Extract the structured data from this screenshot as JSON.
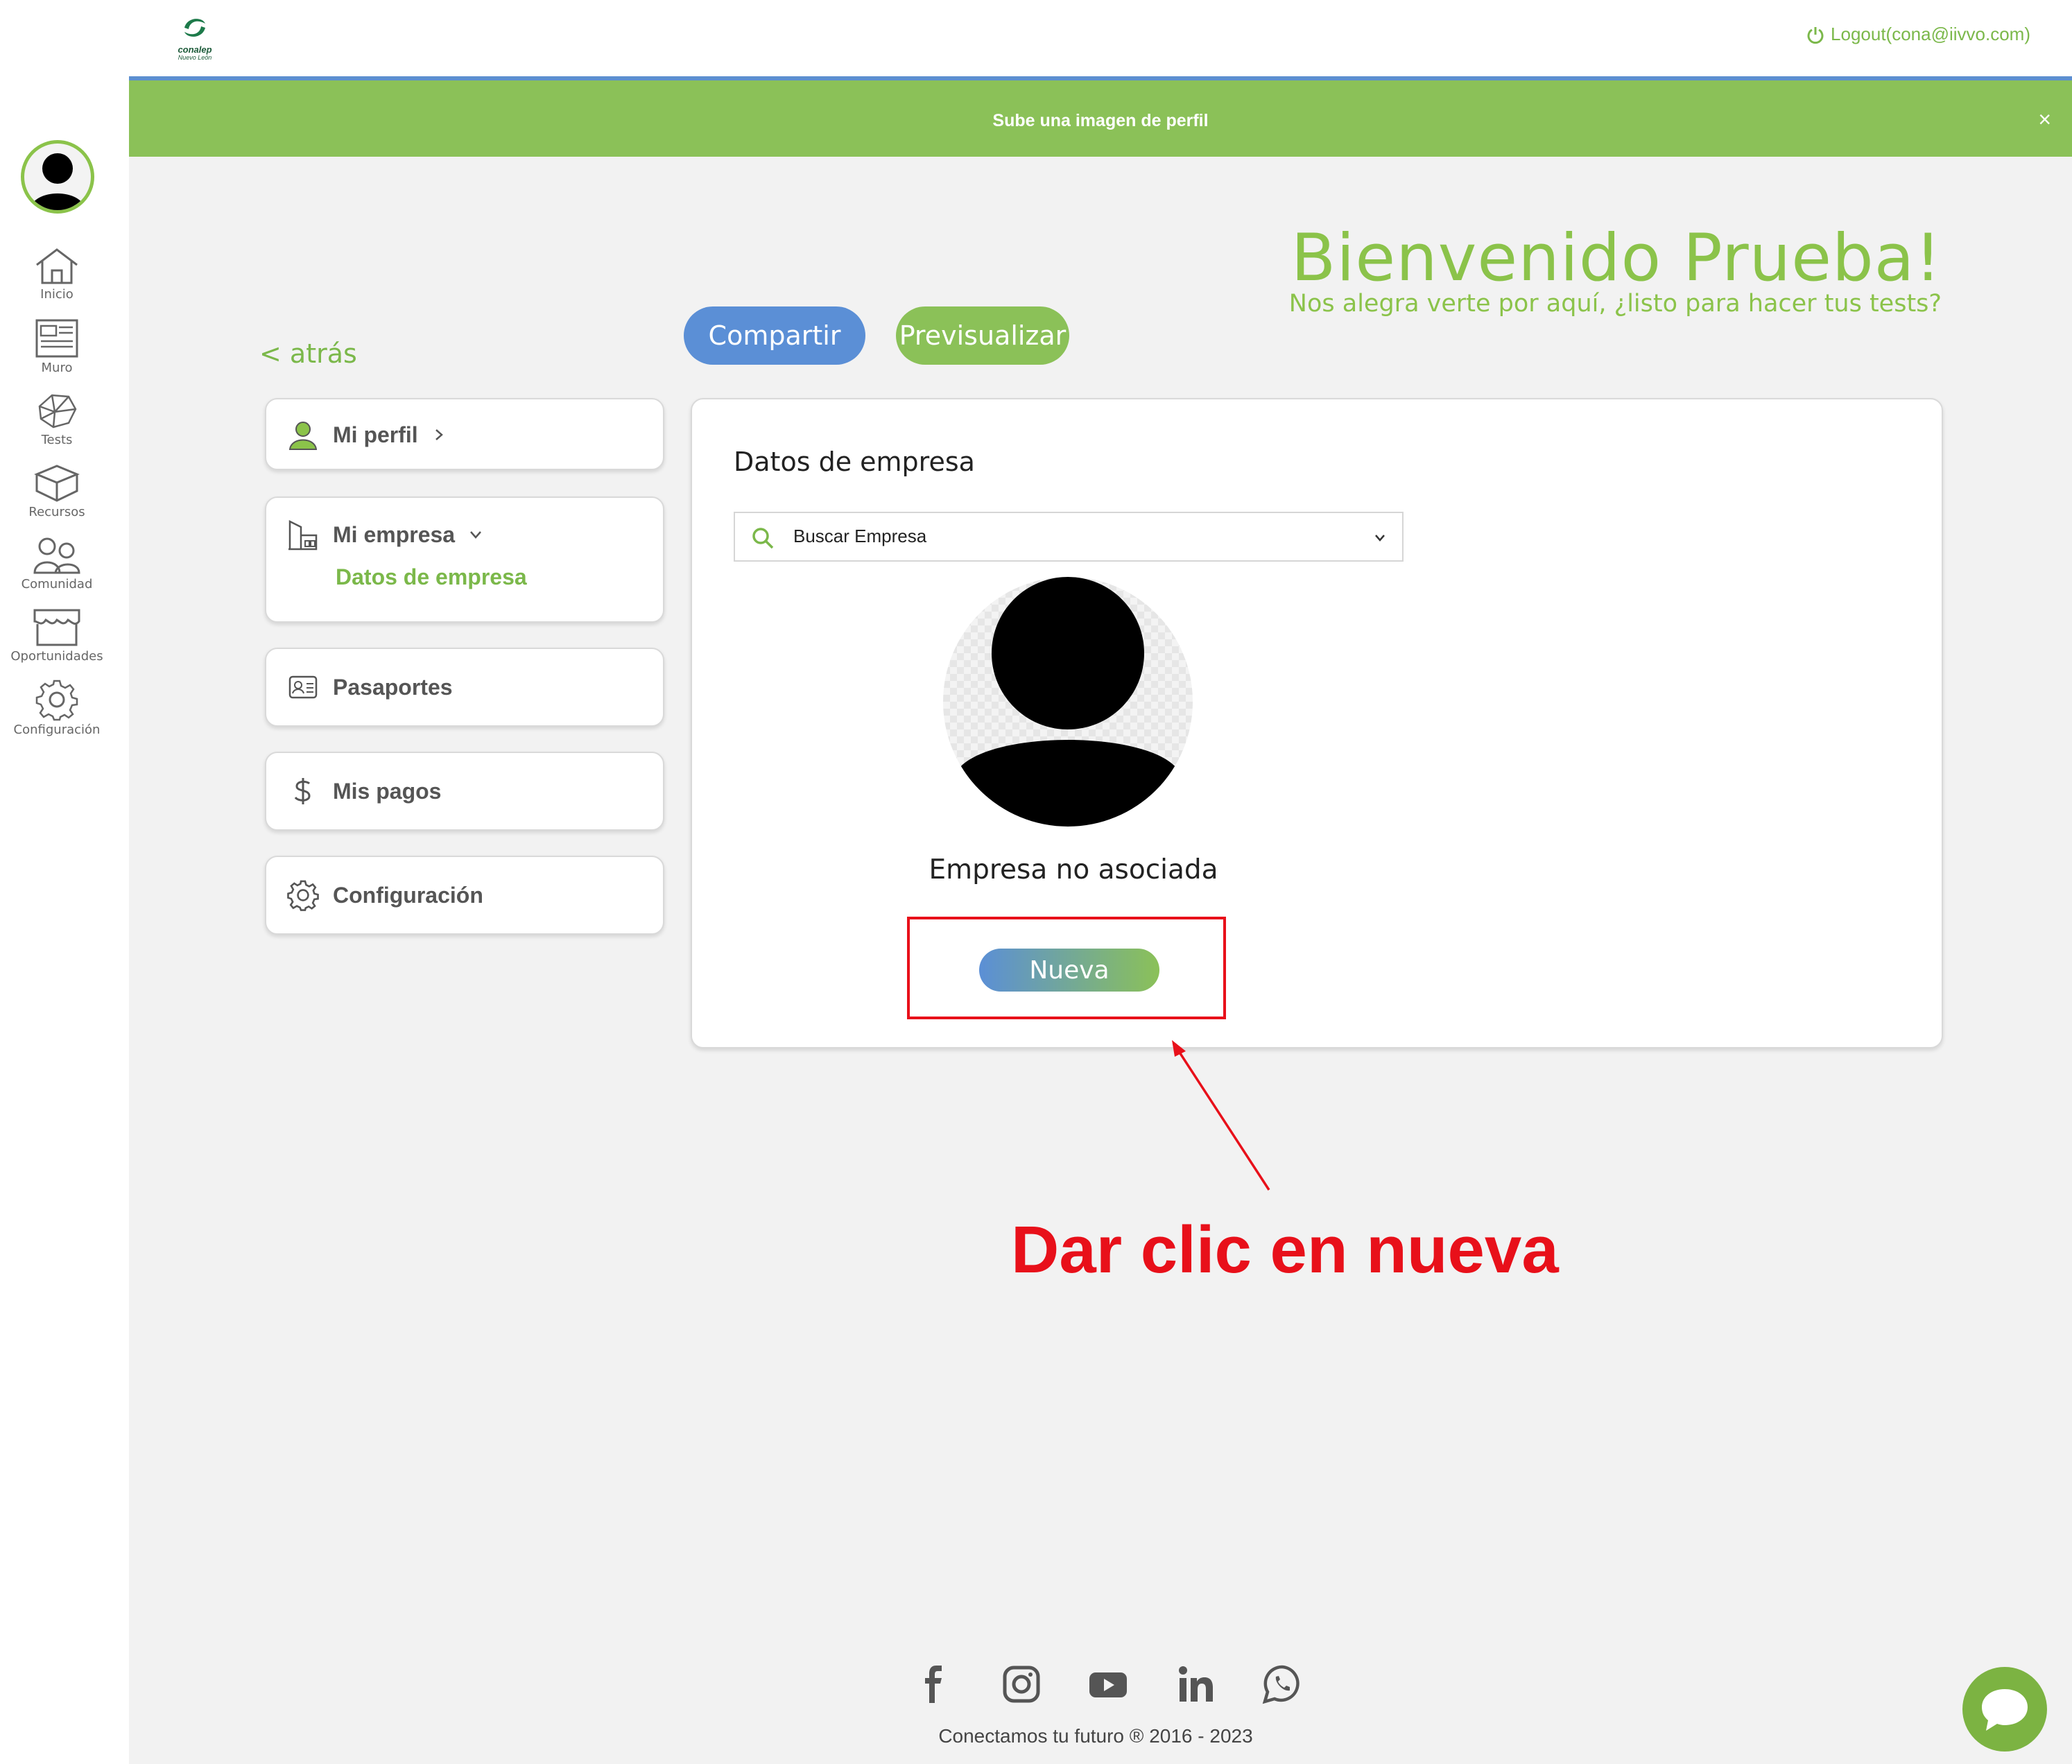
{
  "header": {
    "logo_brand": "conalep",
    "logo_sub": "Nuevo León",
    "logout_label": "Logout(cona@iivvo.com)"
  },
  "banner": {
    "text": "Sube una imagen de perfil",
    "close_symbol": "×"
  },
  "sidebar": {
    "items": [
      {
        "label": "Inicio",
        "icon": "home-icon"
      },
      {
        "label": "Muro",
        "icon": "newspaper-icon"
      },
      {
        "label": "Tests",
        "icon": "brain-icon"
      },
      {
        "label": "Recursos",
        "icon": "box-icon"
      },
      {
        "label": "Comunidad",
        "icon": "people-icon"
      },
      {
        "label": "Oportunidades",
        "icon": "store-icon"
      },
      {
        "label": "Configuración",
        "icon": "gear-icon"
      }
    ]
  },
  "welcome": {
    "title": "Bienvenido Prueba!",
    "subtitle": "Nos alegra verte por aquí, ¿listo para hacer tus tests?"
  },
  "actions": {
    "share_label": "Compartir",
    "preview_label": "Previsualizar",
    "back_label": "< atrás"
  },
  "menu": {
    "profile": "Mi perfil",
    "company": "Mi empresa",
    "company_sub": "Datos de empresa",
    "passports": "Pasaportes",
    "payments": "Mis pagos",
    "settings": "Configuración"
  },
  "content": {
    "title": "Datos de empresa",
    "search_placeholder": "Buscar Empresa",
    "status": "Empresa no asociada",
    "new_button": "Nueva"
  },
  "annotation": {
    "text": "Dar clic en nueva"
  },
  "footer": {
    "social": [
      "facebook-icon",
      "instagram-icon",
      "youtube-icon",
      "linkedin-icon",
      "whatsapp-icon"
    ],
    "copyright": "Conectamos tu futuro ® 2016 - 2023"
  },
  "colors": {
    "brand_green": "#8bc34a",
    "brand_blue": "#5b8fd6",
    "annotation_red": "#e8101a"
  }
}
